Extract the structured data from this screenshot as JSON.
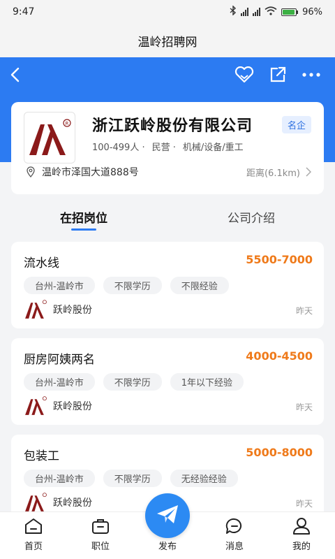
{
  "status_bar": {
    "time": "9:47",
    "battery": "96%",
    "battery_level": 0.96
  },
  "site_title": "温岭招聘网",
  "colors": {
    "brand_blue": "#2c7bf2",
    "salary": "#ef7a1a",
    "badge_text": "#2c6fe0"
  },
  "company": {
    "name": "浙江跃岭股份有限公司",
    "badge": "名企",
    "size": "100-499人",
    "ownership": "民营",
    "industry": "机械/设备/重工",
    "address": "温岭市泽国大道888号",
    "distance": "距离(6.1km)"
  },
  "tabs": [
    {
      "label": "在招岗位",
      "active": true
    },
    {
      "label": "公司介绍",
      "active": false
    }
  ],
  "jobs": [
    {
      "title": "流水线",
      "salary": "5500-7000",
      "tags": [
        "台州-温岭市",
        "不限学历",
        "不限经验"
      ],
      "company": "跃岭股份",
      "time": "昨天"
    },
    {
      "title": "厨房阿姨两名",
      "salary": "4000-4500",
      "tags": [
        "台州-温岭市",
        "不限学历",
        "1年以下经验"
      ],
      "company": "跃岭股份",
      "time": "昨天"
    },
    {
      "title": "包装工",
      "salary": "5000-8000",
      "tags": [
        "台州-温岭市",
        "不限学历",
        "无经验经验"
      ],
      "company": "跃岭股份",
      "time": "昨天"
    }
  ],
  "tabbar": [
    {
      "label": "首页",
      "icon": "home-icon"
    },
    {
      "label": "职位",
      "icon": "briefcase-icon"
    },
    {
      "label": "发布",
      "icon": "paper-plane-icon"
    },
    {
      "label": "消息",
      "icon": "message-icon"
    },
    {
      "label": "我的",
      "icon": "user-icon"
    }
  ]
}
